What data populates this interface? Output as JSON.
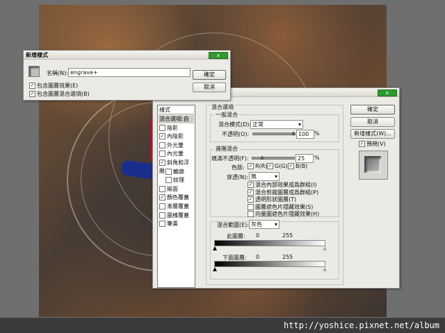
{
  "watermark": "http://yoshice.pixnet.net/album",
  "new_style_dialog": {
    "title": "新增樣式",
    "close": "x",
    "name_label": "名稱(N):",
    "name_value": "engrave+",
    "include_effects": "包含圖層效果(E)",
    "include_blending": "包含圖層混合選項(B)",
    "ok": "確定",
    "cancel": "取消"
  },
  "layer_style_dialog": {
    "close": "x",
    "styles_header": "樣式",
    "styles": [
      {
        "label": "混合選項:自訂",
        "checkbox": false,
        "checked": false,
        "selected": true
      },
      {
        "label": "陰影",
        "checkbox": true,
        "checked": false
      },
      {
        "label": "內陰影",
        "checkbox": true,
        "checked": true
      },
      {
        "label": "外光暈",
        "checkbox": true,
        "checked": false
      },
      {
        "label": "內光暈",
        "checkbox": true,
        "checked": false
      },
      {
        "label": "斜角和浮雕",
        "checkbox": true,
        "checked": true
      },
      {
        "label": "輪廓",
        "checkbox": true,
        "checked": false,
        "indent": true
      },
      {
        "label": "紋理",
        "checkbox": true,
        "checked": false,
        "indent": true
      },
      {
        "label": "緞面",
        "checkbox": true,
        "checked": false
      },
      {
        "label": "顏色覆蓋",
        "checkbox": true,
        "checked": true
      },
      {
        "label": "漸層覆蓋",
        "checkbox": true,
        "checked": false
      },
      {
        "label": "圖樣覆蓋",
        "checkbox": true,
        "checked": false
      },
      {
        "label": "筆畫",
        "checkbox": true,
        "checked": false
      }
    ],
    "blend_options_title": "混合選項",
    "general_blending": "一般混合",
    "blend_mode_label": "混合模式(D):",
    "blend_mode_value": "正常",
    "opacity_label": "不透明(O):",
    "opacity_value": "100",
    "percent": "%",
    "advanced_blending": "進階混合",
    "fill_opacity_label": "填滿不透明(F):",
    "fill_opacity_value": "25",
    "fill_opacity_fraction": 0.25,
    "channels_label": "色版:",
    "channel_r": "R(R)",
    "channel_g": "G(G)",
    "channel_b": "B(B)",
    "knockout_label": "穿透(N):",
    "knockout_value": "無",
    "adv_options": [
      {
        "label": "混合內部效果成爲群組(I)",
        "checked": true
      },
      {
        "label": "混合剪裁圖層成爲群組(P)",
        "checked": true
      },
      {
        "label": "透明形狀圖層(T)",
        "checked": true
      },
      {
        "label": "圖層遮色片隱藏效果(S)",
        "checked": false
      },
      {
        "label": "向量圖遮色片隱藏效果(H)",
        "checked": false
      }
    ],
    "blend_if_label": "混合範圍(E):",
    "blend_if_value": "灰色",
    "this_layer": "此圖層:",
    "underlying_layer": "下面圖層:",
    "range_min": "0",
    "range_max": "255",
    "ok": "確定",
    "cancel": "取消",
    "new_style": "新增樣式(W)...",
    "preview": "預視(V)"
  }
}
